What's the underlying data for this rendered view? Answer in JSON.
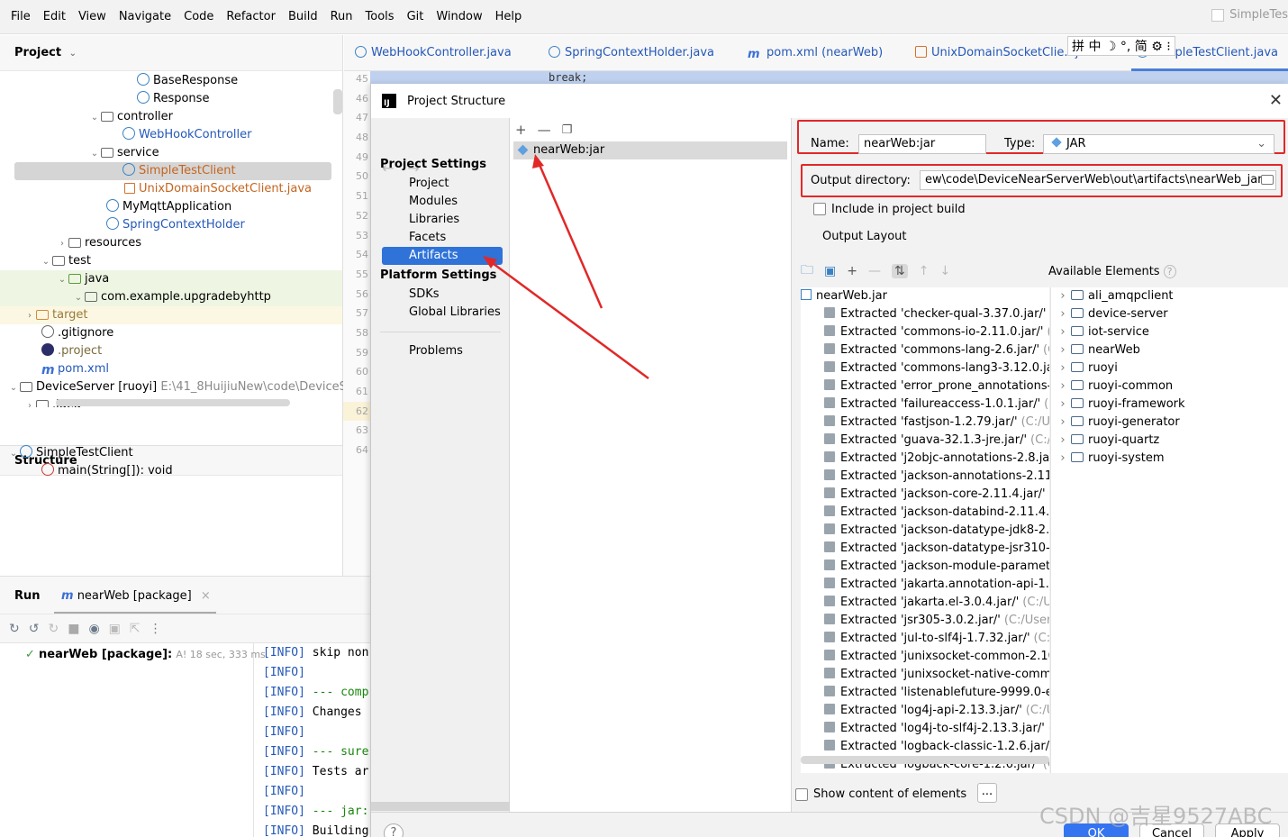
{
  "menu": {
    "items": [
      "File",
      "Edit",
      "View",
      "Navigate",
      "Code",
      "Refactor",
      "Build",
      "Run",
      "Tools",
      "Git",
      "Window",
      "Help"
    ],
    "right_label": "SimpleTes"
  },
  "project_panel": {
    "title": "Project",
    "tree": [
      {
        "label": "BaseResponse",
        "icon": "class-icon"
      },
      {
        "label": "Response",
        "icon": "class-icon"
      },
      {
        "label": "controller",
        "icon": "package-icon"
      },
      {
        "label": "WebHookController",
        "icon": "class-icon"
      },
      {
        "label": "service",
        "icon": "package-icon"
      },
      {
        "label": "SimpleTestClient",
        "icon": "class-icon"
      },
      {
        "label": "UnixDomainSocketClient.java",
        "icon": "java-file-icon"
      },
      {
        "label": "MyMqttApplication",
        "icon": "spring-class-icon"
      },
      {
        "label": "SpringContextHolder",
        "icon": "class-icon"
      },
      {
        "label": "resources",
        "icon": "folder-icon"
      },
      {
        "label": "test",
        "icon": "folder-icon"
      },
      {
        "label": "java",
        "icon": "test-folder-icon"
      },
      {
        "label": "com.example.upgradebyhttp",
        "icon": "package-icon"
      },
      {
        "label": "target",
        "icon": "excluded-folder-icon"
      },
      {
        "label": ".gitignore",
        "icon": "ignore-icon"
      },
      {
        "label": ".project",
        "icon": "eclipse-icon"
      },
      {
        "label": "pom.xml",
        "icon": "maven-icon"
      },
      {
        "label": "DeviceServer [ruoyi]",
        "path": "E:\\41_8HuijiuNew\\code\\DeviceS",
        "icon": "module-icon"
      },
      {
        "label": ".idea",
        "icon": "folder-icon"
      }
    ]
  },
  "structure_panel": {
    "title": "Structure",
    "items": [
      {
        "label": "SimpleTestClient",
        "icon": "class-icon"
      },
      {
        "label": "main(String[]): void",
        "icon": "method-icon"
      }
    ]
  },
  "gutter_lines": [
    "45",
    "46",
    "47",
    "48",
    "49",
    "50",
    "51",
    "52",
    "53",
    "54",
    "55",
    "56",
    "57",
    "58",
    "59",
    "60",
    "61",
    "62",
    "63",
    "64"
  ],
  "editor_tabs": [
    {
      "label": "WebHookController.java",
      "icon": "class-icon"
    },
    {
      "label": "SpringContextHolder.java",
      "icon": "class-icon"
    },
    {
      "label": "pom.xml (nearWeb)",
      "icon": "maven-icon"
    },
    {
      "label": "UnixDomainSocketClie...java",
      "icon": "java-file-icon"
    },
    {
      "label": "SimpleTestClient.java",
      "icon": "class-icon"
    }
  ],
  "ime_bar": "拼 中 ☽ °, 简 ⚙ ⁝",
  "code_strip": "break;",
  "run_panel": {
    "title": "Run",
    "tab_label": "nearWeb [package]",
    "tree_item": "nearWeb [package]:",
    "tree_item_suffix": "A! 18 sec, 333 ms",
    "console": [
      {
        "tag": "[INFO]",
        "text": "skip non"
      },
      {
        "tag": "[INFO]",
        "text": ""
      },
      {
        "tag": "[INFO]",
        "text": "--- comp"
      },
      {
        "tag": "[INFO]",
        "text": "Changes"
      },
      {
        "tag": "[INFO]",
        "text": ""
      },
      {
        "tag": "[INFO]",
        "text": "--- sure"
      },
      {
        "tag": "[INFO]",
        "text": "Tests ar"
      },
      {
        "tag": "[INFO]",
        "text": ""
      },
      {
        "tag": "[INFO]",
        "text": "--- jar:"
      },
      {
        "tag": "[INFO]",
        "text": "Building"
      }
    ]
  },
  "dialog": {
    "title": "Project Structure",
    "project_settings_header": "Project Settings",
    "project_settings": [
      "Project",
      "Modules",
      "Libraries",
      "Facets",
      "Artifacts"
    ],
    "platform_settings_header": "Platform Settings",
    "platform_settings": [
      "SDKs",
      "Global Libraries"
    ],
    "problems": "Problems",
    "selected_nav": "Artifacts",
    "artifact": "nearWeb:jar",
    "name_label": "Name:",
    "name_value": "nearWeb:jar",
    "type_label": "Type:",
    "type_value": "JAR",
    "output_dir_label": "Output directory:",
    "output_dir_value": "ew\\code\\DeviceNearServerWeb\\out\\artifacts\\nearWeb_jar",
    "include_build_label": "Include in project build",
    "output_layout_label": "Output Layout",
    "available_elements_label": "Available Elements",
    "layout_root": "nearWeb.jar",
    "layout_items": [
      {
        "name": "Extracted 'checker-qual-3.37.0.jar/'",
        "path": "("
      },
      {
        "name": "Extracted 'commons-io-2.11.0.jar/'",
        "path": "(C"
      },
      {
        "name": "Extracted 'commons-lang-2.6.jar/'",
        "path": "(C"
      },
      {
        "name": "Extracted 'commons-lang3-3.12.0.jar",
        "path": ""
      },
      {
        "name": "Extracted 'error_prone_annotations-2",
        "path": ""
      },
      {
        "name": "Extracted 'failureaccess-1.0.1.jar/'",
        "path": "(C:"
      },
      {
        "name": "Extracted 'fastjson-1.2.79.jar/'",
        "path": "(C:/Us"
      },
      {
        "name": "Extracted 'guava-32.1.3-jre.jar/'",
        "path": "(C:/U"
      },
      {
        "name": "Extracted 'j2objc-annotations-2.8.jar",
        "path": ""
      },
      {
        "name": "Extracted 'jackson-annotations-2.11.4",
        "path": ""
      },
      {
        "name": "Extracted 'jackson-core-2.11.4.jar/'",
        "path": "("
      },
      {
        "name": "Extracted 'jackson-databind-2.11.4.ja",
        "path": ""
      },
      {
        "name": "Extracted 'jackson-datatype-jdk8-2.1",
        "path": ""
      },
      {
        "name": "Extracted 'jackson-datatype-jsr310-2",
        "path": ""
      },
      {
        "name": "Extracted 'jackson-module-paramete",
        "path": ""
      },
      {
        "name": "Extracted 'jakarta.annotation-api-1.3.",
        "path": ""
      },
      {
        "name": "Extracted 'jakarta.el-3.0.4.jar/'",
        "path": "(C:/Us"
      },
      {
        "name": "Extracted 'jsr305-3.0.2.jar/'",
        "path": "(C:/User"
      },
      {
        "name": "Extracted 'jul-to-slf4j-1.7.32.jar/'",
        "path": "(C:/"
      },
      {
        "name": "Extracted 'junixsocket-common-2.10",
        "path": ""
      },
      {
        "name": "Extracted 'junixsocket-native-commo",
        "path": ""
      },
      {
        "name": "Extracted 'listenablefuture-9999.0-e",
        "path": ""
      },
      {
        "name": "Extracted 'log4j-api-2.13.3.jar/'",
        "path": "(C:/U"
      },
      {
        "name": "Extracted 'log4j-to-slf4j-2.13.3.jar/'",
        "path": "("
      },
      {
        "name": "Extracted 'logback-classic-1.2.6.jar/'",
        "path": ""
      },
      {
        "name": "Extracted 'logback-core-1.2.6.jar/'",
        "path": "(C"
      }
    ],
    "available_elements": [
      "ali_amqpclient",
      "device-server",
      "iot-service",
      "nearWeb",
      "ruoyi",
      "ruoyi-common",
      "ruoyi-framework",
      "ruoyi-generator",
      "ruoyi-quartz",
      "ruoyi-system"
    ],
    "show_content_label": "Show content of elements",
    "ellipsis_button": "...",
    "ok_button": "OK",
    "cancel_button": "Cancel",
    "apply_button": "Apply",
    "help_button": "?"
  },
  "watermark": "CSDN @吉星9527ABC",
  "colors": {
    "selection": "#2f73d8",
    "annotation_red": "#e12828",
    "link_blue": "#2458b8"
  }
}
